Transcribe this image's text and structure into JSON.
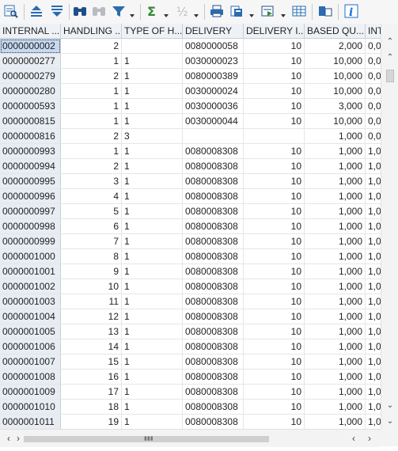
{
  "toolbar": {
    "buttons": [
      {
        "name": "details-icon",
        "label": "Details"
      },
      {
        "name": "sort-ascending-icon",
        "label": "Sort Ascending"
      },
      {
        "name": "sort-descending-icon",
        "label": "Sort Descending"
      },
      {
        "name": "find-icon",
        "label": "Find"
      },
      {
        "name": "find-next-icon",
        "label": "Find Next"
      },
      {
        "name": "filter-icon",
        "label": "Set Filter"
      },
      {
        "name": "total-icon",
        "label": "Total"
      },
      {
        "name": "subtotals-icon",
        "label": "Subtotals"
      },
      {
        "name": "print-preview-icon",
        "label": "Print Preview"
      },
      {
        "name": "export-icon",
        "label": "Export"
      },
      {
        "name": "layout-icon",
        "label": "Change Layout"
      },
      {
        "name": "spreadsheet-icon",
        "label": "Spreadsheet"
      },
      {
        "name": "select-layout-icon",
        "label": "Select Layout"
      },
      {
        "name": "information-icon",
        "label": "Information"
      }
    ]
  },
  "columns": [
    "INTERNAL ...",
    "HANDLING ...",
    "TYPE OF H...",
    "DELIVERY",
    "DELIVERY I...",
    "BASED QU...",
    "INT"
  ],
  "rows": [
    [
      "0000000002",
      "2",
      "",
      "0080000058",
      "10",
      "2,000",
      "0,0"
    ],
    [
      "0000000277",
      "1",
      "1",
      "0030000023",
      "10",
      "10,000",
      "0,0"
    ],
    [
      "0000000279",
      "2",
      "1",
      "0080000389",
      "10",
      "10,000",
      "0,0"
    ],
    [
      "0000000280",
      "1",
      "1",
      "0030000024",
      "10",
      "10,000",
      "0,0"
    ],
    [
      "0000000593",
      "1",
      "1",
      "0030000036",
      "10",
      "3,000",
      "0,0"
    ],
    [
      "0000000815",
      "1",
      "1",
      "0030000044",
      "10",
      "10,000",
      "0,0"
    ],
    [
      "0000000816",
      "2",
      "3",
      "",
      "",
      "1,000",
      "0,0"
    ],
    [
      "0000000993",
      "1",
      "1",
      "0080008308",
      "10",
      "1,000",
      "1,0"
    ],
    [
      "0000000994",
      "2",
      "1",
      "0080008308",
      "10",
      "1,000",
      "1,0"
    ],
    [
      "0000000995",
      "3",
      "1",
      "0080008308",
      "10",
      "1,000",
      "1,0"
    ],
    [
      "0000000996",
      "4",
      "1",
      "0080008308",
      "10",
      "1,000",
      "1,0"
    ],
    [
      "0000000997",
      "5",
      "1",
      "0080008308",
      "10",
      "1,000",
      "1,0"
    ],
    [
      "0000000998",
      "6",
      "1",
      "0080008308",
      "10",
      "1,000",
      "1,0"
    ],
    [
      "0000000999",
      "7",
      "1",
      "0080008308",
      "10",
      "1,000",
      "1,0"
    ],
    [
      "0000001000",
      "8",
      "1",
      "0080008308",
      "10",
      "1,000",
      "1,0"
    ],
    [
      "0000001001",
      "9",
      "1",
      "0080008308",
      "10",
      "1,000",
      "1,0"
    ],
    [
      "0000001002",
      "10",
      "1",
      "0080008308",
      "10",
      "1,000",
      "1,0"
    ],
    [
      "0000001003",
      "11",
      "1",
      "0080008308",
      "10",
      "1,000",
      "1,0"
    ],
    [
      "0000001004",
      "12",
      "1",
      "0080008308",
      "10",
      "1,000",
      "1,0"
    ],
    [
      "0000001005",
      "13",
      "1",
      "0080008308",
      "10",
      "1,000",
      "1,0"
    ],
    [
      "0000001006",
      "14",
      "1",
      "0080008308",
      "10",
      "1,000",
      "1,0"
    ],
    [
      "0000001007",
      "15",
      "1",
      "0080008308",
      "10",
      "1,000",
      "1,0"
    ],
    [
      "0000001008",
      "16",
      "1",
      "0080008308",
      "10",
      "1,000",
      "1,0"
    ],
    [
      "0000001009",
      "17",
      "1",
      "0080008308",
      "10",
      "1,000",
      "1,0"
    ],
    [
      "0000001010",
      "18",
      "1",
      "0080008308",
      "10",
      "1,000",
      "1,0"
    ],
    [
      "0000001011",
      "19",
      "1",
      "0080008308",
      "10",
      "1,000",
      "1,0"
    ]
  ],
  "colors": {
    "header_bg": "#eef2f7",
    "key_bg": "#e8edf3",
    "selected_bg": "#c5d9f1",
    "grid_line": "#e3e6ea",
    "toolbar_bg": "#f6f6f6",
    "info_icon": "#1f6fd0"
  }
}
